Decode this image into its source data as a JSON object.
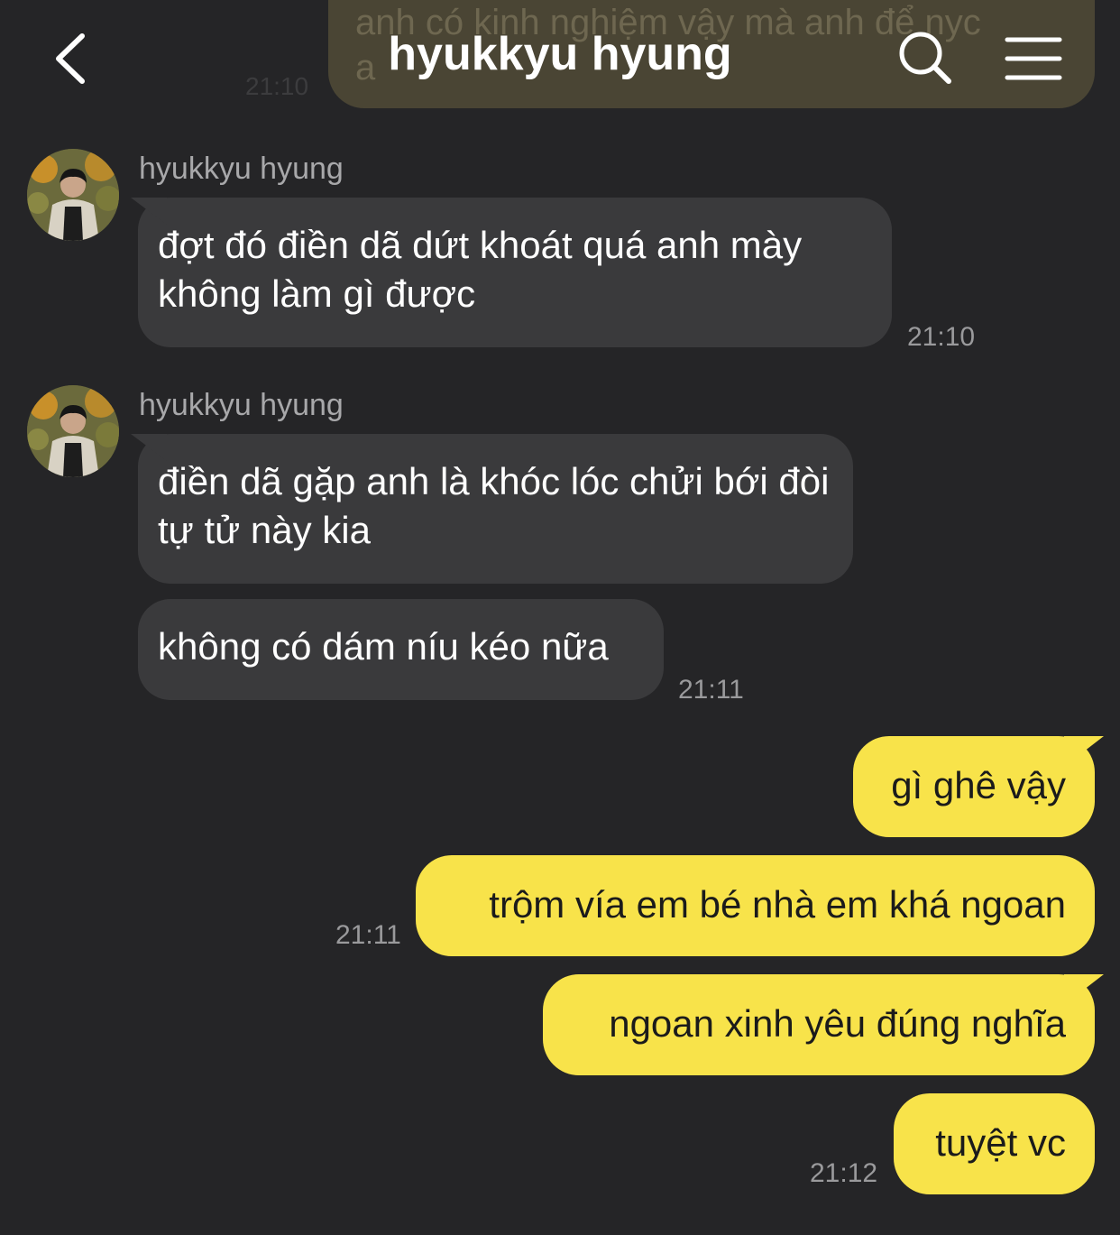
{
  "header": {
    "title": "hyukkyu hyung",
    "back_icon": "chevron-left-icon",
    "search_icon": "search-icon",
    "menu_icon": "menu-icon",
    "ghost_message": "anh có kinh nghiệm vậy mà anh để nyc",
    "ghost_message_line2": "a",
    "ghost_time": "21:10"
  },
  "messages": [
    {
      "direction": "in",
      "sender": "hyukkyu hyung",
      "text": "đợt đó điền dã dứt khoát quá anh mày không làm gì được",
      "time": "21:10"
    },
    {
      "direction": "in",
      "sender": "hyukkyu hyung",
      "text": "điền dã gặp anh là khóc lóc chửi bới đòi tự tử này kia"
    },
    {
      "direction": "in",
      "text": "không có dám níu kéo nữa",
      "time": "21:11"
    },
    {
      "direction": "out",
      "text": "gì ghê vậy"
    },
    {
      "direction": "out",
      "text": "trộm vía em bé nhà em khá ngoan",
      "time": "21:11"
    },
    {
      "direction": "out",
      "text": "ngoan xinh yêu đúng nghĩa"
    },
    {
      "direction": "out",
      "text": "tuyệt vc",
      "time": "21:12"
    }
  ],
  "colors": {
    "background": "#252527",
    "incoming_bubble": "#3a3a3c",
    "outgoing_bubble": "#f8e34a",
    "timestamp": "#9a9a9c"
  }
}
